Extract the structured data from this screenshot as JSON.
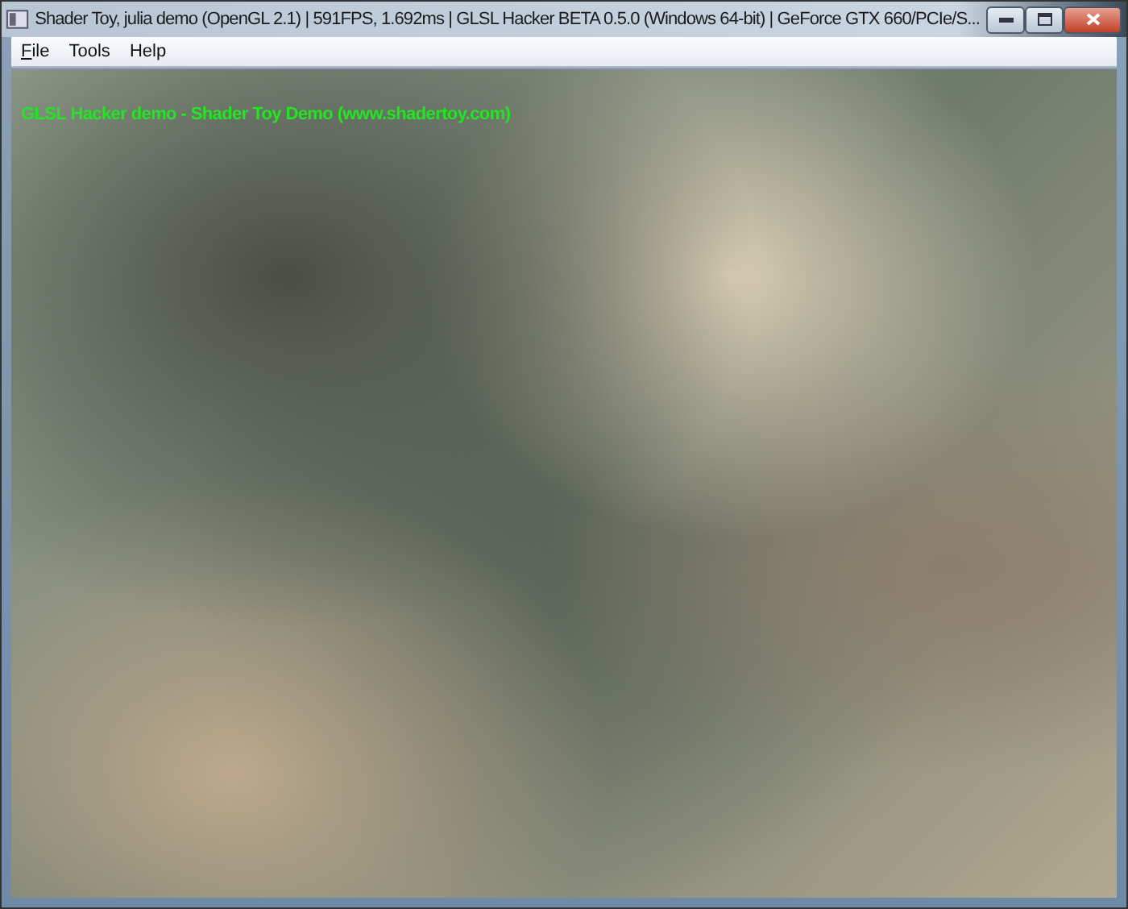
{
  "window": {
    "title": "Shader Toy, julia demo (OpenGL 2.1) | 591FPS, 1.692ms | GLSL Hacker BETA 0.5.0 (Windows 64-bit) | GeForce GTX 660/PCIe/S..."
  },
  "menu": [
    {
      "label": "File",
      "mnemonic": true
    },
    {
      "label": "Tools",
      "mnemonic": false
    },
    {
      "label": "Help",
      "mnemonic": false
    }
  ],
  "render": {
    "overlay_text": "GLSL Hacker demo - Shader Toy Demo (www.shadertoy.com)"
  }
}
